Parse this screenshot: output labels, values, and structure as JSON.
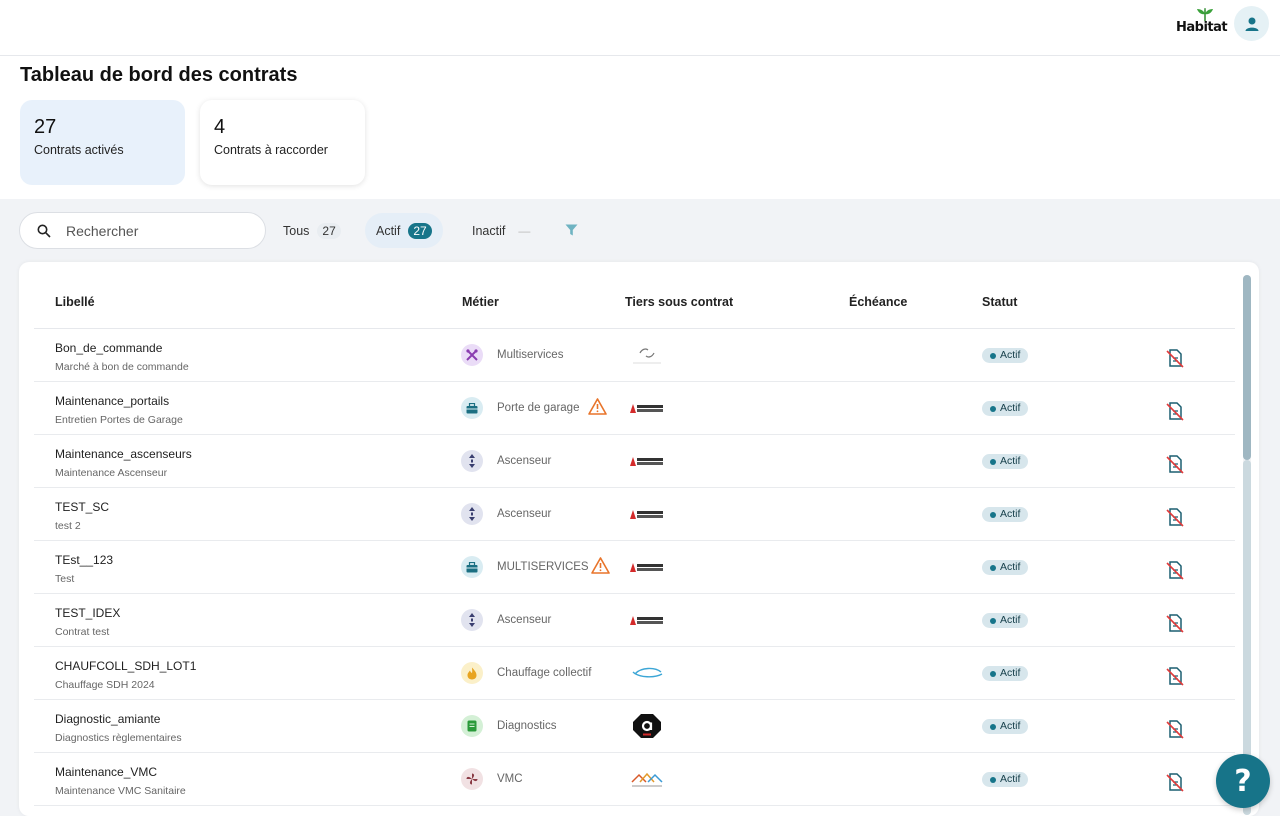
{
  "brand": {
    "name": "Habitat",
    "accent": "#17758a"
  },
  "page": {
    "title": "Tableau de bord des contrats"
  },
  "stats": [
    {
      "value": "27",
      "label": "Contrats activés"
    },
    {
      "value": "4",
      "label": "Contrats à raccorder"
    }
  ],
  "search": {
    "placeholder": "Rechercher",
    "value": ""
  },
  "filters": {
    "tous": {
      "label": "Tous",
      "count": "27"
    },
    "actif": {
      "label": "Actif",
      "count": "27",
      "selected": true
    },
    "inactif": {
      "label": "Inactif",
      "count": "—"
    }
  },
  "table": {
    "columns": [
      "Libellé",
      "Métier",
      "Tiers sous contrat",
      "Échéance",
      "Statut"
    ],
    "rows": [
      {
        "title": "Bon_de_commande",
        "subtitle": "Marché à bon de commande",
        "metier": "Multiservices",
        "metier_icon": "tools-icon",
        "warning": false,
        "tiers_logo": "generic-logo",
        "echeance": "",
        "status": "Actif"
      },
      {
        "title": "Maintenance_portails",
        "subtitle": "Entretien Portes de Garage",
        "metier": "Porte de garage",
        "metier_icon": "toolbox-icon",
        "warning": true,
        "tiers_logo": "elevator-logo",
        "echeance": "",
        "status": "Actif"
      },
      {
        "title": "Maintenance_ascenseurs",
        "subtitle": "Maintenance Ascenseur",
        "metier": "Ascenseur",
        "metier_icon": "elevator-icon",
        "warning": false,
        "tiers_logo": "elevator-logo",
        "echeance": "",
        "status": "Actif"
      },
      {
        "title": "TEST_SC",
        "subtitle": "test 2",
        "metier": "Ascenseur",
        "metier_icon": "elevator-icon",
        "warning": false,
        "tiers_logo": "elevator-logo",
        "echeance": "",
        "status": "Actif"
      },
      {
        "title": "TEst__123",
        "subtitle": "Test",
        "metier": "MULTISERVICES",
        "metier_icon": "toolbox-icon",
        "warning": true,
        "tiers_logo": "elevator-logo",
        "echeance": "",
        "status": "Actif"
      },
      {
        "title": "TEST_IDEX",
        "subtitle": "Contrat test",
        "metier": "Ascenseur",
        "metier_icon": "elevator-icon",
        "warning": false,
        "tiers_logo": "elevator-logo",
        "echeance": "",
        "status": "Actif"
      },
      {
        "title": "CHAUFCOLL_SDH_LOT1",
        "subtitle": "Chauffage SDH 2024",
        "metier": "Chauffage collectif",
        "metier_icon": "flame-icon",
        "warning": false,
        "tiers_logo": "engie-logo",
        "echeance": "",
        "status": "Actif"
      },
      {
        "title": "Diagnostic_amiante",
        "subtitle": "Diagnostics règlementaires",
        "metier": "Diagnostics",
        "metier_icon": "document-icon",
        "warning": false,
        "tiers_logo": "a-logo",
        "echeance": "",
        "status": "Actif"
      },
      {
        "title": "Maintenance_VMC",
        "subtitle": "Maintenance VMC Sanitaire",
        "metier": "VMC",
        "metier_icon": "fan-icon",
        "warning": false,
        "tiers_logo": "roof-logo",
        "echeance": "",
        "status": "Actif"
      }
    ]
  },
  "help": {
    "label": "?"
  }
}
